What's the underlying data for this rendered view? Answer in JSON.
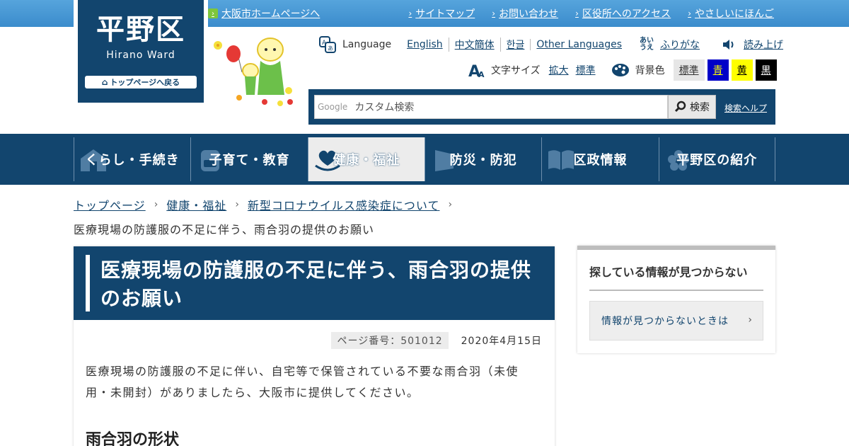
{
  "topbar": {
    "osaka_link": "大阪市ホームページへ",
    "links": [
      "サイトマップ",
      "お問い合わせ",
      "区役所へのアクセス",
      "やさしいにほんご"
    ]
  },
  "logo": {
    "title": "平野区",
    "subtitle": "Hirano Ward",
    "top_button": "トップページへ戻る"
  },
  "language": {
    "label": "Language",
    "links": [
      "English",
      "中文簡体",
      "한글",
      "Other Languages"
    ],
    "furigana_icon_top": "あい",
    "furigana_icon_bottom": "うえ",
    "furigana": "ふりがな",
    "read_aloud": "読み上げ"
  },
  "font_size": {
    "label": "文字サイズ",
    "enlarge": "拡大",
    "standard": "標準"
  },
  "background": {
    "label": "背景色",
    "standard": "標準",
    "blue": "青",
    "yellow": "黄",
    "black": "黒"
  },
  "search": {
    "google_mark": "Google",
    "placeholder": "カスタム検索",
    "button": "検索",
    "help": "検索ヘルプ"
  },
  "nav": {
    "items": [
      "くらし・手続き",
      "子育て・教育",
      "健康・福祉",
      "防災・防犯",
      "区政情報",
      "平野区の紹介"
    ]
  },
  "breadcrumb": {
    "items": [
      "トップページ",
      "健康・福祉",
      "新型コロナウイルス感染症について"
    ],
    "current": "医療現場の防護服の不足に伴う、雨合羽の提供のお願い"
  },
  "article": {
    "title": "医療現場の防護服の不足に伴う、雨合羽の提供のお願い",
    "page_number": "ページ番号：501012",
    "date": "2020年4月15日",
    "body": "医療現場の防護服の不足に伴い、自宅等で保管されている不要な雨合羽（未使用・未開封）がありましたら、大阪市に提供してください。",
    "subheading": "雨合羽の形状"
  },
  "side": {
    "title": "探している情報が見つからない",
    "link": "情報が見つからないときは"
  },
  "colors": {
    "brand_navy": "#12456e",
    "topbar_blue": "#3b8ccc",
    "link_green": "#7ec63c"
  }
}
